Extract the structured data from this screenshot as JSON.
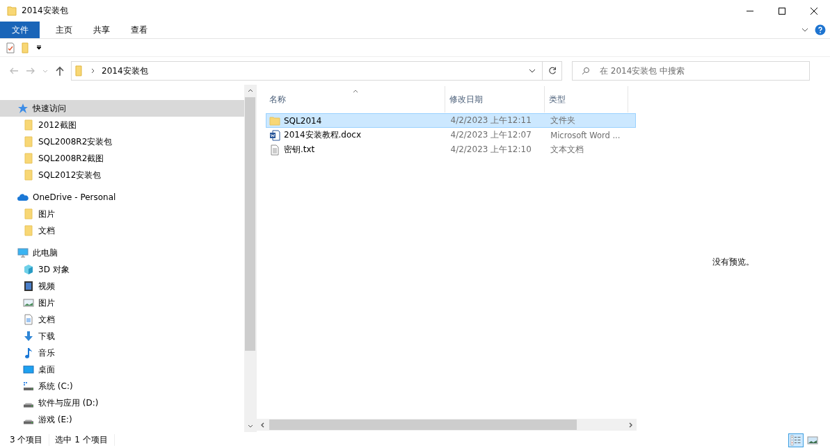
{
  "window": {
    "title": "2014安装包"
  },
  "ribbon_tabs": [
    {
      "label": "文件",
      "selected": true
    },
    {
      "label": "主页",
      "selected": false
    },
    {
      "label": "共享",
      "selected": false
    },
    {
      "label": "查看",
      "selected": false
    }
  ],
  "address_bar": {
    "path": [
      "2014安装包"
    ]
  },
  "search": {
    "placeholder": "在 2014安装包 中搜索"
  },
  "nav_pane": [
    {
      "label": "快速访问",
      "kind": "star",
      "selected": true,
      "children": [
        {
          "label": "2012截图",
          "kind": "folder"
        },
        {
          "label": "SQL2008R2安装包",
          "kind": "folder"
        },
        {
          "label": "SQL2008R2截图",
          "kind": "folder"
        },
        {
          "label": "SQL2012安装包",
          "kind": "folder"
        }
      ]
    },
    {
      "label": "OneDrive - Personal",
      "kind": "cloud",
      "selected": false,
      "children": [
        {
          "label": "图片",
          "kind": "folder"
        },
        {
          "label": "文档",
          "kind": "folder"
        }
      ]
    },
    {
      "label": "此电脑",
      "kind": "pc",
      "selected": false,
      "children": [
        {
          "label": "3D 对象",
          "kind": "cube"
        },
        {
          "label": "视频",
          "kind": "video"
        },
        {
          "label": "图片",
          "kind": "picture"
        },
        {
          "label": "文档",
          "kind": "document"
        },
        {
          "label": "下载",
          "kind": "download"
        },
        {
          "label": "音乐",
          "kind": "music"
        },
        {
          "label": "桌面",
          "kind": "desktop"
        },
        {
          "label": "系统 (C:)",
          "kind": "system-drive"
        },
        {
          "label": "软件与应用 (D:)",
          "kind": "drive"
        },
        {
          "label": "游戏 (E:)",
          "kind": "drive"
        }
      ]
    }
  ],
  "file_list": {
    "columns": [
      "名称",
      "修改日期",
      "类型"
    ],
    "rows": [
      {
        "name": "SQL2014",
        "kind": "folder",
        "date": "4/2/2023 上午12:11",
        "type": "文件夹",
        "selected": true
      },
      {
        "name": "2014安装教程.docx",
        "kind": "word",
        "date": "4/2/2023 上午12:07",
        "type": "Microsoft Word ...",
        "selected": false
      },
      {
        "name": "密钥.txt",
        "kind": "text",
        "date": "4/2/2023 上午12:10",
        "type": "文本文档",
        "selected": false
      }
    ]
  },
  "preview_pane": {
    "message": "没有预览。"
  },
  "status_bar": {
    "item_count": "3 个项目",
    "selection": "选中 1 个项目"
  },
  "view_buttons": [
    {
      "kind": "details",
      "selected": true
    },
    {
      "kind": "large-icons",
      "selected": false
    }
  ]
}
